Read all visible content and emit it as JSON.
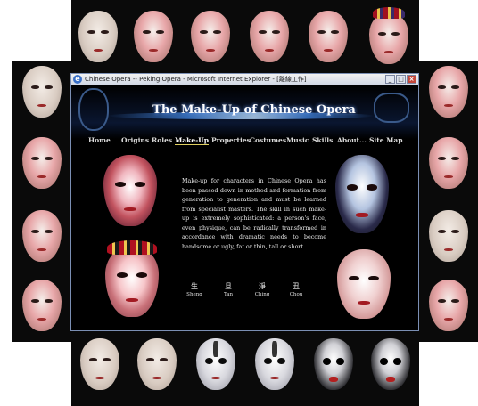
{
  "window": {
    "title": "Chinese Opera -- Peking Opera - Microsoft Internet Explorer - [離線工作]",
    "controls": {
      "minimize": "_",
      "maximize": "□",
      "close": "×"
    },
    "browser_icon": "e"
  },
  "site": {
    "title": "The Make-Up of Chinese Opera"
  },
  "nav": {
    "items": [
      {
        "label": "Home"
      },
      {
        "label": "Origins"
      },
      {
        "label": "Roles"
      },
      {
        "label": "Make-Up"
      },
      {
        "label": "Properties"
      },
      {
        "label": "Costumes"
      },
      {
        "label": "Music"
      },
      {
        "label": "Skills"
      },
      {
        "label": "About..."
      },
      {
        "label": "Site Map"
      }
    ],
    "active": "Make-Up"
  },
  "content": {
    "intro": "Make-up for characters in Chinese Opera has been passed down in method and formation from generation to generation and must be learned from specialist masters. The skill in such make-up is extremely sophisticated: a person's face, even physique, can be radically transformed in accordance with dramatic needs to become handsome or ugly, fat or thin, tall or short."
  },
  "roles": [
    {
      "char": "生",
      "name": "Sheng"
    },
    {
      "char": "旦",
      "name": "Tan"
    },
    {
      "char": "淨",
      "name": "Ching"
    },
    {
      "char": "丑",
      "name": "Chou"
    }
  ],
  "icons": {
    "browser": "ie-icon",
    "logo": "mask-logo-icon",
    "site_map": "chinese-character-icon"
  }
}
